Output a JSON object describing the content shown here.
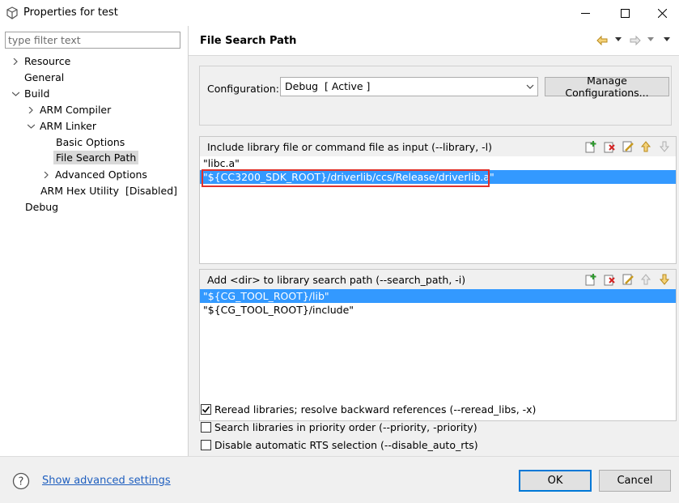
{
  "window": {
    "title": "Properties for test"
  },
  "sidebar": {
    "filter_placeholder": "type filter text",
    "tree": [
      {
        "label": "Resource"
      },
      {
        "label": "General"
      },
      {
        "label": "Build"
      },
      {
        "label": "ARM Compiler"
      },
      {
        "label": "ARM Linker"
      },
      {
        "label": "Basic Options"
      },
      {
        "label": "File Search Path"
      },
      {
        "label": "Advanced Options"
      },
      {
        "label": "ARM Hex Utility  [Disabled]"
      },
      {
        "label": "Debug"
      }
    ]
  },
  "main": {
    "title": "File Search Path",
    "configuration": {
      "label": "Configuration:",
      "value": "Debug  [ Active ]",
      "manage_label": "Manage Configurations..."
    },
    "include_list": {
      "title": "Include library file or command file as input (--library, -l)",
      "items": [
        "\"libc.a\"",
        "\"${CC3200_SDK_ROOT}/driverlib/ccs/Release/driverlib.a\""
      ]
    },
    "search_path_list": {
      "title": "Add <dir> to library search path (--search_path, -i)",
      "items": [
        "\"${CG_TOOL_ROOT}/lib\"",
        "\"${CG_TOOL_ROOT}/include\""
      ]
    },
    "options": [
      {
        "label": "Reread libraries; resolve backward references (--reread_libs, -x)",
        "checked": true
      },
      {
        "label": "Search libraries in priority order (--priority, -priority)",
        "checked": false
      },
      {
        "label": "Disable automatic RTS selection (--disable_auto_rts)",
        "checked": false
      }
    ]
  },
  "footer": {
    "advanced_link": "Show advanced settings",
    "ok_label": "OK",
    "cancel_label": "Cancel"
  },
  "colors": {
    "selection": "#3399ff",
    "highlight_border": "#e0302a",
    "link": "#1f5fbf"
  }
}
